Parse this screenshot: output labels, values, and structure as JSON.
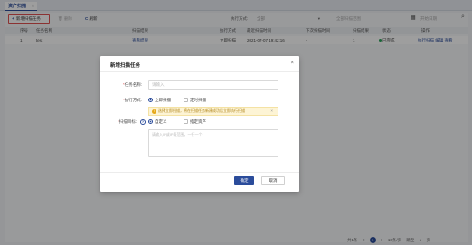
{
  "tabs": [
    {
      "label": "资产扫描",
      "close": "×"
    }
  ],
  "toolbar": {
    "new_task_icon": "+",
    "new_task_label": "新增扫描任务",
    "delete_label": "删除",
    "refresh_icon": "C",
    "refresh_label": "刷新",
    "exec_mode_label": "执行方式:",
    "exec_mode_value": "全部",
    "target_placeholder": "全部扫描范围",
    "time_placeholder": "开始日期",
    "calendar_icon": "calendar-icon",
    "search_icon": "search-icon"
  },
  "table": {
    "headers": [
      "序号",
      "任务名称",
      "扫描结果",
      "执行方式",
      "最近扫描时间",
      "下次扫描时间",
      "扫描结果",
      "状态",
      "操作"
    ],
    "rows": [
      {
        "index": "1",
        "name": "test",
        "result": "查看结果",
        "exec_mode": "立即扫描",
        "last_time": "2021-07-07 19:42:16",
        "next_time": "-",
        "result_count": "1",
        "status": "已完成",
        "actions": "执行扫描 编辑 查看"
      }
    ]
  },
  "pager": {
    "total": "共1条",
    "prev": "<",
    "current": "1",
    "next": ">",
    "page_size": "10条/页",
    "goto_label": "跳至",
    "goto_value": "1",
    "page_unit": "页"
  },
  "modal": {
    "title": "新增扫描任务",
    "close": "×",
    "task_name_label": "任务名称:",
    "task_name_placeholder": "请输入",
    "exec_mode_label": "执行方式:",
    "exec_options": [
      "立即扫描",
      "定时扫描"
    ],
    "warning_icon": "!",
    "warning_text": "选择立即扫描，将在扫描任务新建成功后立即执行扫描",
    "warning_close": "×",
    "scan_target_label": "扫描目标:",
    "help_icon": "?",
    "target_options": [
      "自定义",
      "指定资产"
    ],
    "target_placeholder": "请输入IP或IP段范围，一行一个",
    "ok_label": "确定",
    "cancel_label": "取消"
  },
  "colors": {
    "primary": "#2b4c9b",
    "danger": "#e05252",
    "warning_bg": "#fdf4d5",
    "success": "#2aa45b"
  }
}
